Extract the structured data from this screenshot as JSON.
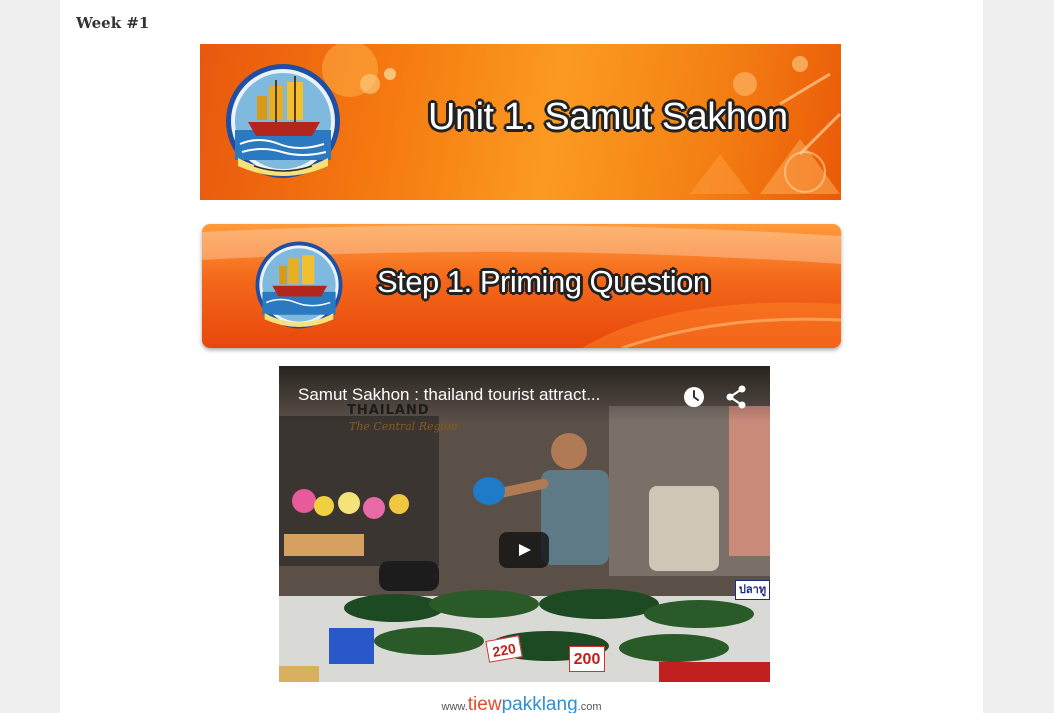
{
  "week_title": "Week #1",
  "banner_unit": {
    "title": "Unit 1. Samut Sakhon"
  },
  "banner_step": {
    "title": "Step 1. Priming Question"
  },
  "video": {
    "title": "Samut Sakhon : thailand tourist attract...",
    "watermark_top": "THAILAND",
    "watermark_sub": "The Central Region",
    "prices": [
      "220",
      "200"
    ],
    "sign": "ปลาทู"
  },
  "website": {
    "prefix": "www.",
    "name_a": "tiew",
    "name_b": "pakklang",
    "suffix": ".com"
  },
  "colors": {
    "banner_orange": "#f57a10",
    "banner_red": "#e8470c",
    "page_bg": "#efefef"
  }
}
